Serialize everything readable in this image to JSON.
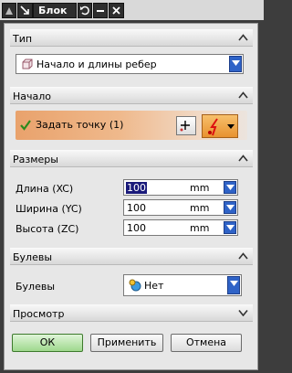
{
  "window": {
    "title": "Блок"
  },
  "sections": {
    "type": {
      "label": "Тип",
      "dropdown_value": "Начало и длины ребер"
    },
    "origin": {
      "label": "Начало",
      "point_label": "Задать точку (1)"
    },
    "dimensions": {
      "label": "Размеры",
      "rows": [
        {
          "label": "Длина (XC)",
          "value": "100",
          "unit": "mm"
        },
        {
          "label": "Ширина (YC)",
          "value": "100",
          "unit": "mm"
        },
        {
          "label": "Высота (ZC)",
          "value": "100",
          "unit": "mm"
        }
      ]
    },
    "boolean": {
      "label": "Булевы",
      "row_label": "Булевы",
      "dropdown_value": "Нет"
    },
    "preview": {
      "label": "Просмотр"
    }
  },
  "buttons": {
    "ok": "ОК",
    "apply": "Применить",
    "cancel": "Отмена"
  },
  "colors": {
    "ok_button": "#9ed88d",
    "dropdown_arrow": "#2f63c7",
    "origin_highlight": "#e9a26c"
  }
}
